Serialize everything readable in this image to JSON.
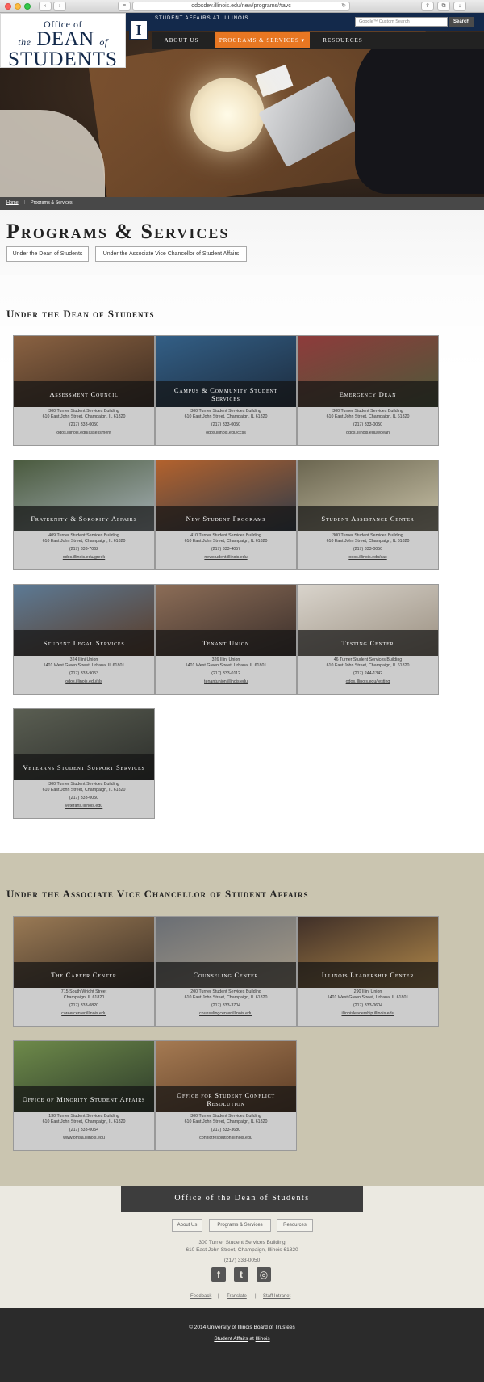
{
  "browser": {
    "url": "odosdev.illinois.edu/new/programs/#avc"
  },
  "header": {
    "logo": {
      "line1": "Office of",
      "line2a": "the",
      "line2b": "Dean",
      "line2c": "of",
      "line3": "Students"
    },
    "unit_label": "Student Affairs at Illinois",
    "i_mark": "I",
    "search_placeholder": "Google™ Custom Search",
    "search_button": "Search",
    "nav": [
      "About Us",
      "Programs & Services",
      "Resources"
    ],
    "nav_active_arrow": "▾"
  },
  "breadcrumb": {
    "home": "Home",
    "sep": "|",
    "current": "Programs & Services"
  },
  "page": {
    "title": "Programs & Services",
    "subnav": [
      "Under the Dean of Students",
      "Under the Associate Vice Chancellor of Student Affairs"
    ]
  },
  "sections": [
    {
      "heading": "Under the Dean of Students",
      "cards": [
        {
          "name": "Assessment Council",
          "addr1": "300 Turner Student Services Building",
          "addr2": "610 East John Street, Champaign, IL 61820",
          "phone": "(217) 333-0050",
          "link": "odos.illinois.edu/assessment"
        },
        {
          "name": "Campus & Community Student Services",
          "addr1": "300 Turner Student Services Building",
          "addr2": "610 East John Street, Champaign, IL 61820",
          "phone": "(217) 333-0050",
          "link": "odos.illinois.edu/ccss"
        },
        {
          "name": "Emergency Dean",
          "addr1": "300 Turner Student Services Building",
          "addr2": "610 East John Street, Champaign, IL 61820",
          "phone": "(217) 333-0050",
          "link": "odos.illinois.edu/edean"
        },
        {
          "name": "Fraternity & Sorority Affairs",
          "addr1": "409 Turner Student Services Building",
          "addr2": "610 East John Street, Champaign, IL 61820",
          "phone": "(217) 333-7062",
          "link": "odos.illinois.edu/greek"
        },
        {
          "name": "New Student Programs",
          "addr1": "410 Turner Student Services Building",
          "addr2": "610 East John Street, Champaign, IL 61820",
          "phone": "(217) 333-4057",
          "link": "newstudent.illinois.edu"
        },
        {
          "name": "Student Assistance Center",
          "addr1": "300 Turner Student Services Building",
          "addr2": "610 East John Street, Champaign, IL 61820",
          "phone": "(217) 333-0050",
          "link": "odos.illinois.edu/sac"
        },
        {
          "name": "Student Legal Services",
          "addr1": "324 Illini Union",
          "addr2": "1401 West Green Street, Urbana, IL 61801",
          "phone": "(217) 333-9053",
          "link": "odos.illinois.edu/sls"
        },
        {
          "name": "Tenant Union",
          "addr1": "326 Illini Union",
          "addr2": "1401 West Green Street, Urbana, IL 61801",
          "phone": "(217) 333-0112",
          "link": "tenantunion.illinois.edu"
        },
        {
          "name": "Testing Center",
          "addr1": "46 Turner Student Services Building",
          "addr2": "610 East John Street, Champaign, IL 61820",
          "phone": "(217) 244-1342",
          "link": "odos.illinois.edu/testing"
        },
        {
          "name": "Veterans Student Support Services",
          "addr1": "300 Turner Student Services Building",
          "addr2": "610 East John Street, Champaign, IL 61820",
          "phone": "(217) 333-0050",
          "link": "veterans.illinois.edu"
        }
      ]
    },
    {
      "heading": "Under the Associate Vice Chancellor of Student Affairs",
      "cards": [
        {
          "name": "The Career Center",
          "addr1": "715 South Wright Street",
          "addr2": "Champaign, IL 61820",
          "phone": "(217) 333-0820",
          "link": "careercenter.illinois.edu"
        },
        {
          "name": "Counseling Center",
          "addr1": "200 Turner Student Services Building",
          "addr2": "610 East John Street, Champaign, IL 61820",
          "phone": "(217) 333-3704",
          "link": "counselingcenter.illinois.edu"
        },
        {
          "name": "Illinois Leadership Center",
          "addr1": "290 Illini Union",
          "addr2": "1401 West Green Street, Urbana, IL 61801",
          "phone": "(217) 333-0604",
          "link": "illinoisleadership.illinois.edu"
        },
        {
          "name": "Office of Minority Student Affairs",
          "addr1": "130 Turner Student Services Building",
          "addr2": "610 East John Street, Champaign, IL 61820",
          "phone": "(217) 333-0054",
          "link": "www.omsa.illinois.edu"
        },
        {
          "name": "Office for Student Conflict Resolution",
          "addr1": "300 Turner Student Services Building",
          "addr2": "610 East John Street, Champaign, IL 61820",
          "phone": "(217) 333-3680",
          "link": "conflictresolution.illinois.edu"
        }
      ]
    }
  ],
  "footer": {
    "banner": "Office of the Dean of Students",
    "buttons": [
      "About Us",
      "Programs & Services",
      "Resources"
    ],
    "addr1": "300 Turner Student Services Building",
    "addr2": "610 East John Street, Champaign, Illinois 61820",
    "phone": "(217) 333-0050",
    "social": [
      "f",
      "t",
      "◎"
    ],
    "links": [
      "Feedback",
      "Translate",
      "Staff Intranet"
    ],
    "copyright": "© 2014 University of Illinois Board of Trustees",
    "credit_a": "Student Affairs",
    "credit_mid": "at",
    "credit_b": "Illinois"
  },
  "colors": {
    "navy": "#13294b",
    "orange": "#e87722",
    "tan": "#cac5b0"
  }
}
